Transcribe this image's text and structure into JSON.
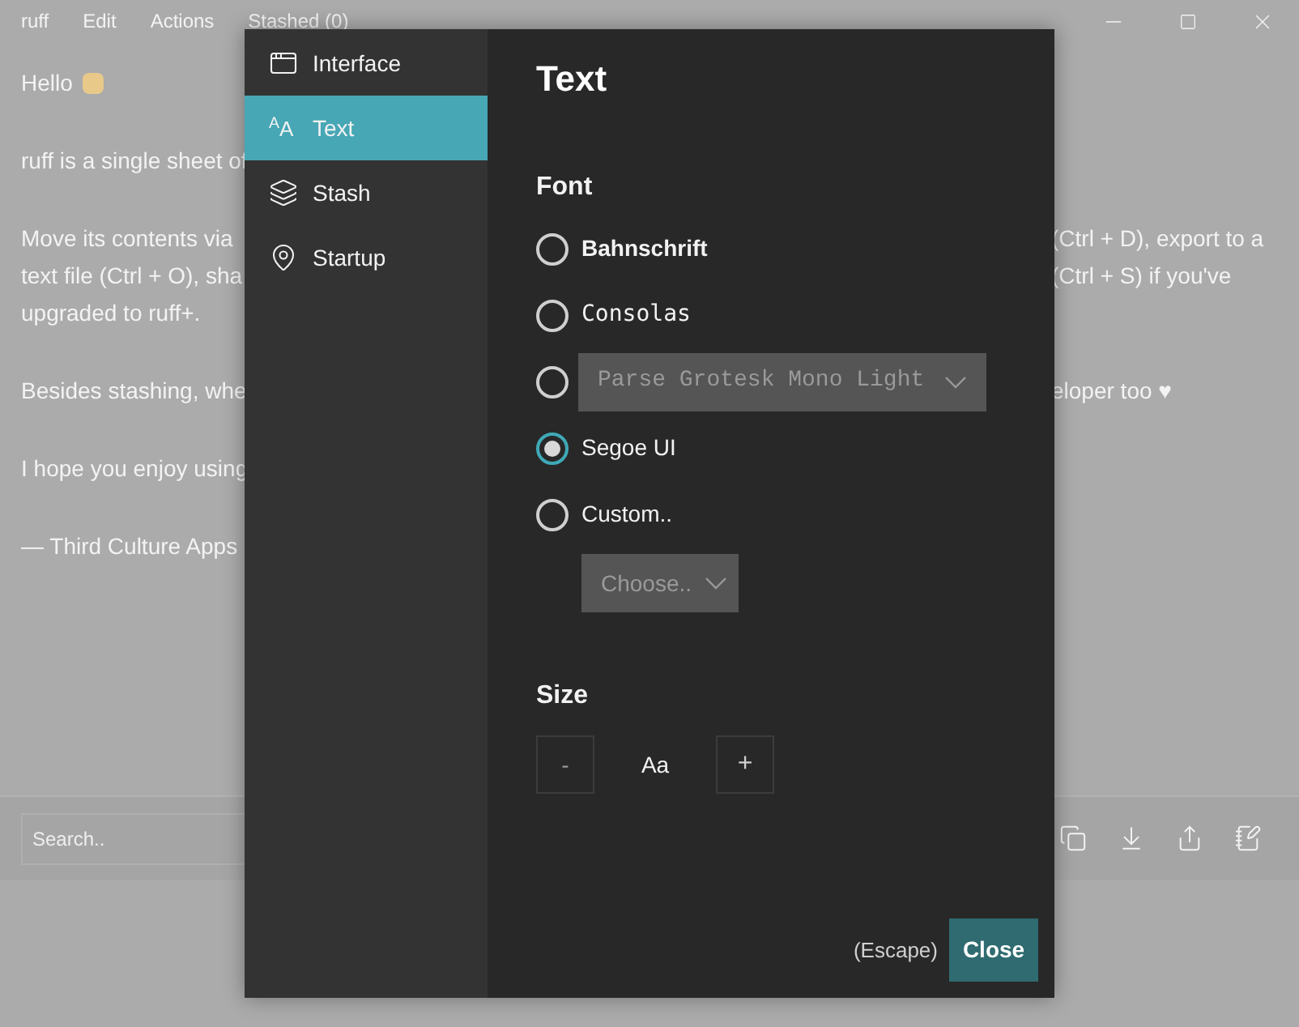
{
  "window": {
    "menu": [
      "ruff",
      "Edit",
      "Actions",
      "Stashed (0)"
    ]
  },
  "document": {
    "paragraphs": [
      {
        "lines": [
          {
            "left": "Hello"
          }
        ]
      },
      {
        "lines": [
          {
            "left": "ruff is a single sheet of"
          }
        ]
      },
      {
        "lines": [
          {
            "left": "Move its contents via",
            "right": "(Ctrl + D), export to a"
          },
          {
            "left": "text file (Ctrl + O), sha",
            "right": "(Ctrl + S) if you've"
          },
          {
            "left": "upgraded to ruff+."
          }
        ]
      },
      {
        "lines": [
          {
            "left": "Besides stashing, whe",
            "right": "eloper too ♥"
          }
        ]
      },
      {
        "lines": [
          {
            "left": "I hope you enjoy using"
          }
        ]
      },
      {
        "lines": [
          {
            "left": "— Third Culture Apps"
          }
        ]
      }
    ]
  },
  "toolbar": {
    "search": {
      "placeholder": "Search.."
    }
  },
  "settings": {
    "nav": [
      {
        "label": "Interface",
        "selected": false
      },
      {
        "label": "Text",
        "glyph": "$^{A}$A",
        "selected": true
      },
      {
        "label": "Stash",
        "selected": false
      },
      {
        "label": "Startup",
        "selected": false
      }
    ],
    "title": "Text",
    "font": {
      "heading": "Font",
      "options": [
        {
          "kind": "display",
          "label": "Bahnschrift",
          "selected": false
        },
        {
          "kind": "mono",
          "label": "Consolas",
          "selected": false
        },
        {
          "kind": "picker",
          "value": "Parse Grotesk Mono Light",
          "selected": false
        },
        {
          "kind": "plain",
          "label": "Segoe UI",
          "selected": true
        },
        {
          "kind": "custom",
          "label": "Custom..",
          "placeholder": "Choose..",
          "selected": false
        }
      ]
    },
    "size": {
      "heading": "Size",
      "decrease": "-",
      "sample": "Aa",
      "increase": "+"
    },
    "footer": {
      "hint": "(Escape)",
      "button": "Close"
    }
  }
}
